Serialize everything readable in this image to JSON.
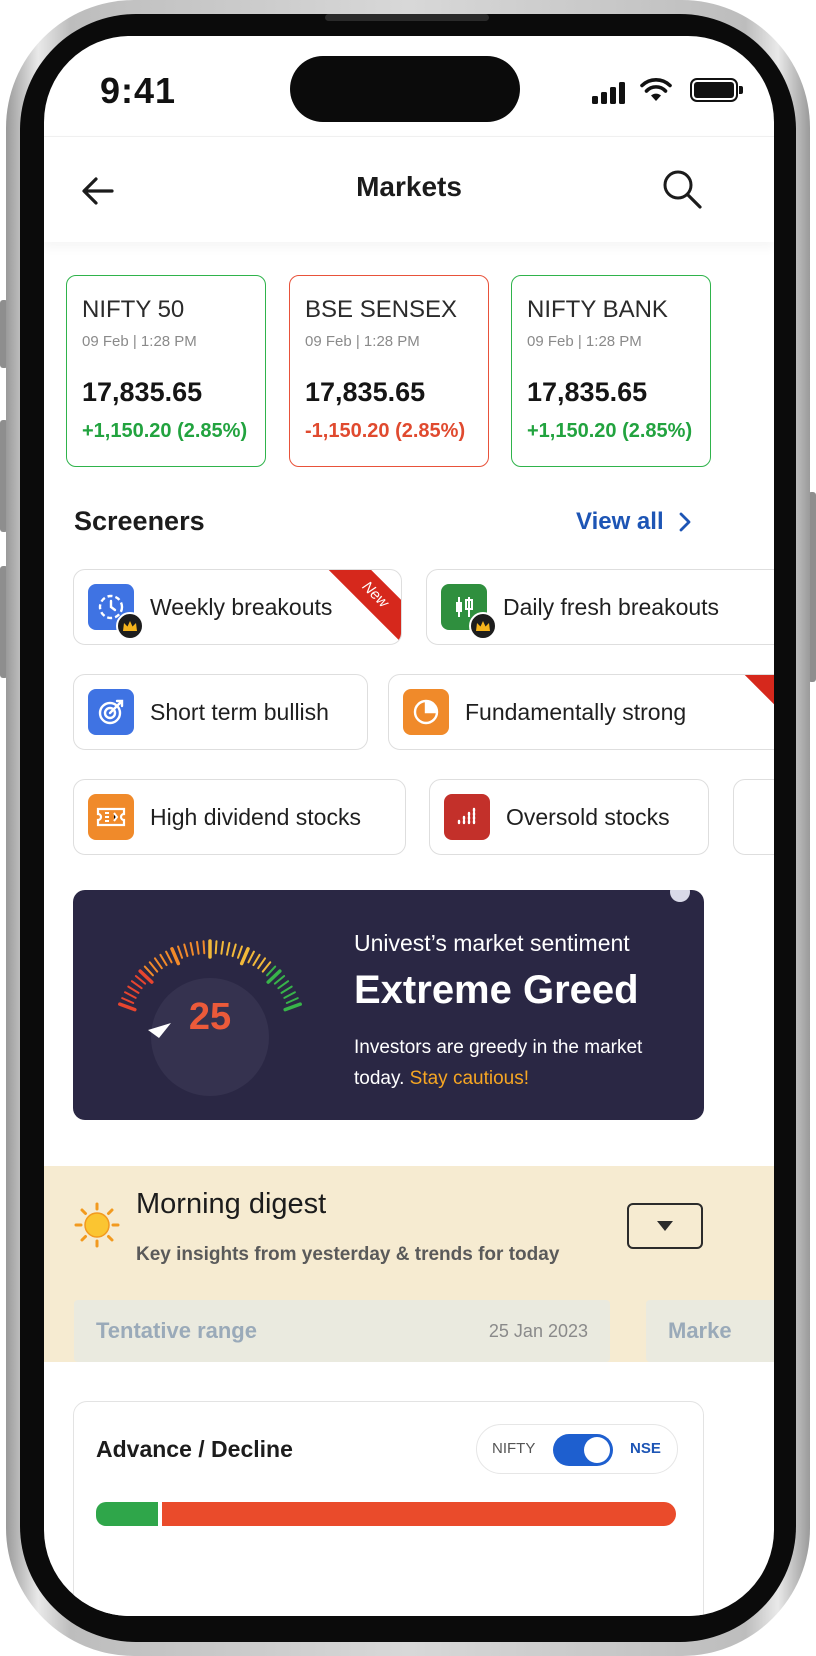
{
  "status_bar": {
    "time": "9:41"
  },
  "header": {
    "title": "Markets"
  },
  "indices": [
    {
      "name": "NIFTY 50",
      "date": "09 Feb | 1:28 PM",
      "value": "17,835.65",
      "change": "+1,150.20 (2.85%)",
      "trend": "up"
    },
    {
      "name": "BSE SENSEX",
      "date": "09 Feb | 1:28 PM",
      "value": "17,835.65",
      "change": "-1,150.20 (2.85%)",
      "trend": "down"
    },
    {
      "name": "NIFTY BANK",
      "date": "09 Feb | 1:28 PM",
      "value": "17,835.65",
      "change": "+1,150.20 (2.85%)",
      "trend": "up"
    }
  ],
  "screeners": {
    "title": "Screeners",
    "view_all": "View all",
    "items": [
      {
        "label": "Weekly breakouts",
        "icon": "clock-icon",
        "color": "#3f73e3",
        "badge": "New"
      },
      {
        "label": "Daily fresh breakouts",
        "icon": "candlestick-icon",
        "color": "#2f8f3e"
      },
      {
        "label": "Short term bullish",
        "icon": "target-icon",
        "color": "#3f73e3"
      },
      {
        "label": "Fundamentally strong",
        "icon": "pie-chart-icon",
        "color": "#f08a2a"
      },
      {
        "label": "High dividend stocks",
        "icon": "ticket-icon",
        "color": "#f08a2a"
      },
      {
        "label": "Oversold stocks",
        "icon": "bar-chart-icon",
        "color": "#c3302a"
      }
    ]
  },
  "sentiment": {
    "value": "25",
    "subtitle": "Univest’s market sentiment",
    "title": "Extreme Greed",
    "description": "Investors are greedy in the market today.",
    "warning": "Stay cautious!"
  },
  "digest": {
    "title": "Morning digest",
    "subtitle": "Key insights from yesterday & trends for today",
    "rows": [
      {
        "label": "Tentative range",
        "date": "25 Jan 2023"
      },
      {
        "label": "Marke"
      }
    ]
  },
  "advance_decline": {
    "title": "Advance / Decline",
    "toggle_left": "NIFTY",
    "toggle_right": "NSE"
  }
}
